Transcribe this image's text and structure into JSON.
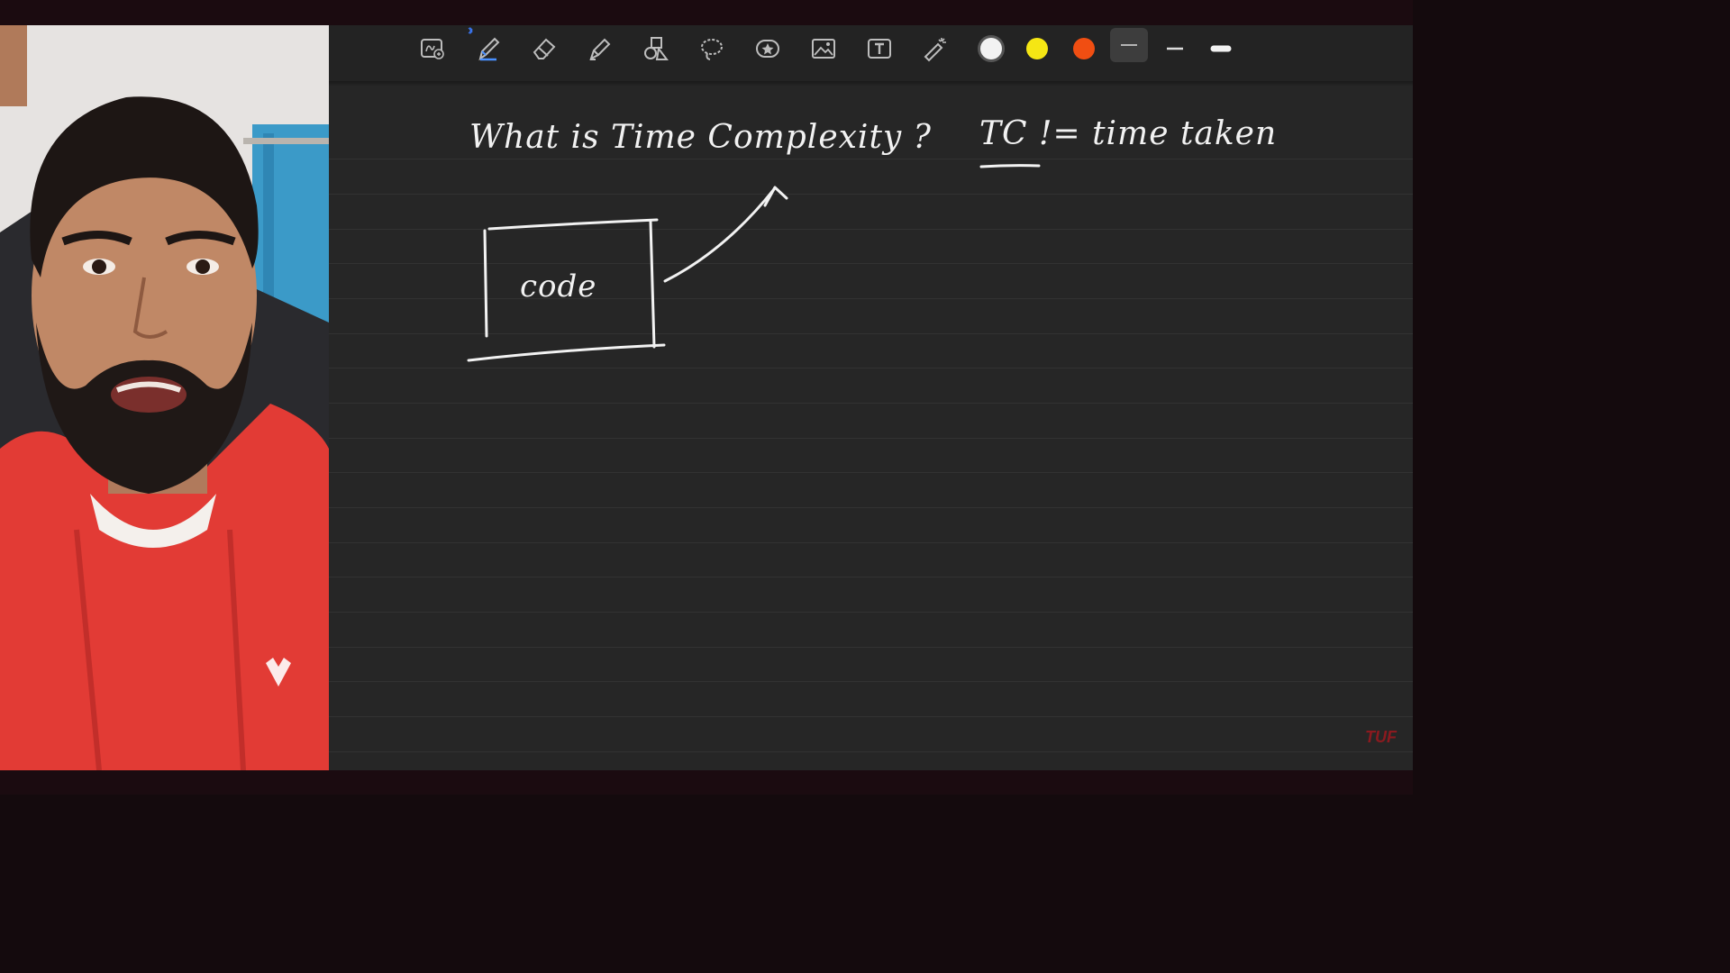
{
  "toolbar": {
    "tools": [
      {
        "name": "scan-tool-icon"
      },
      {
        "name": "pen-tool-icon"
      },
      {
        "name": "eraser-tool-icon"
      },
      {
        "name": "highlighter-tool-icon"
      },
      {
        "name": "shapes-tool-icon"
      },
      {
        "name": "lasso-tool-icon"
      },
      {
        "name": "sticker-tool-icon"
      },
      {
        "name": "image-tool-icon"
      },
      {
        "name": "text-tool-icon"
      },
      {
        "name": "laser-pointer-tool-icon"
      }
    ],
    "colors": [
      "#f2f2f2",
      "#f5e614",
      "#f04e12"
    ],
    "selected_tool": "pen-tool-icon"
  },
  "handwriting": {
    "question": "What is Time Complexity ?",
    "note": "TC != time taken",
    "box_label": "code"
  },
  "watermark": "TUF"
}
